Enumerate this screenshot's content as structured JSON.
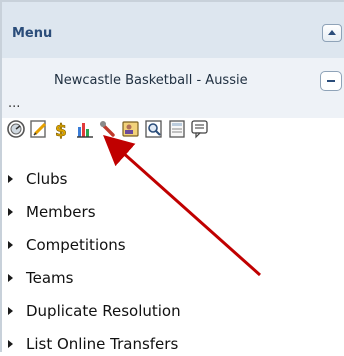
{
  "menu": {
    "title": "Menu",
    "organisation": "Newcastle Basketball - Aussie",
    "ellipsis": "..."
  },
  "toolbar": {
    "icons": [
      "dashboard-icon",
      "edit-icon",
      "money-icon",
      "reports-icon",
      "tools-icon",
      "user-card-icon",
      "search-icon",
      "calculator-icon",
      "messages-icon"
    ]
  },
  "nav": {
    "items": [
      {
        "label": "Clubs"
      },
      {
        "label": "Members"
      },
      {
        "label": "Competitions"
      },
      {
        "label": "Teams"
      },
      {
        "label": "Duplicate Resolution"
      },
      {
        "label": "List Online Transfers"
      }
    ]
  },
  "colors": {
    "header_bg": "#dde6ef",
    "subheader_bg": "#eef2f7",
    "title_text": "#2b4d7a",
    "annotation_arrow": "#c00000"
  }
}
